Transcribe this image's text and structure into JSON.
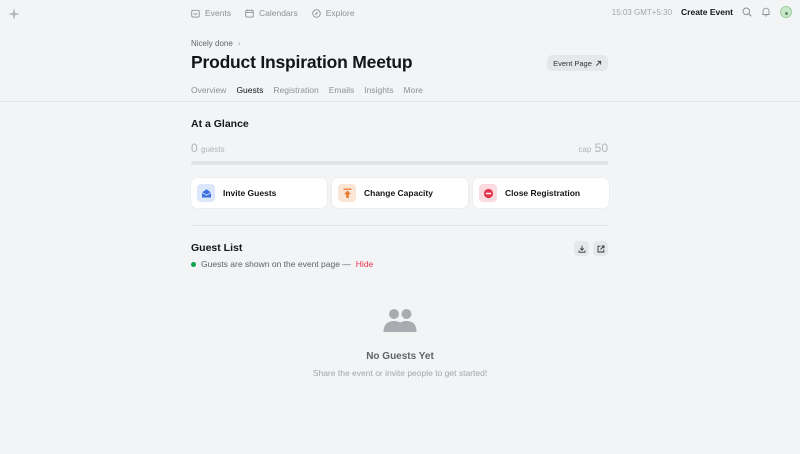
{
  "nav": {
    "links": [
      {
        "label": "Events",
        "icon": "calendar-ticket-icon"
      },
      {
        "label": "Calendars",
        "icon": "calendar-icon"
      },
      {
        "label": "Explore",
        "icon": "compass-icon"
      }
    ],
    "time": "15:03 GMT+5:30",
    "create_label": "Create Event"
  },
  "header": {
    "breadcrumb": "Nicely done",
    "title": "Product Inspiration Meetup",
    "event_page_label": "Event Page",
    "tabs": [
      "Overview",
      "Guests",
      "Registration",
      "Emails",
      "Insights",
      "More"
    ],
    "active_tab": "Guests"
  },
  "glance": {
    "title": "At a Glance",
    "guest_count": "0",
    "guest_unit": "guests",
    "cap_unit": "cap",
    "cap_value": "50",
    "progress_fraction": 0,
    "actions": [
      {
        "label": "Invite Guests",
        "icon": "envelope-icon",
        "color": "#3b6fe0",
        "bg": "#dde7fb"
      },
      {
        "label": "Change Capacity",
        "icon": "capacity-arrow-up-icon",
        "color": "#e87a2f",
        "bg": "#fbe6d6"
      },
      {
        "label": "Close Registration",
        "icon": "stop-circle-icon",
        "color": "#e5344d",
        "bg": "#fadbe0"
      }
    ]
  },
  "guest_list": {
    "title": "Guest List",
    "shown_text": "Guests are shown on the event page —",
    "hide_label": "Hide",
    "empty_title": "No Guests Yet",
    "empty_subtitle": "Share the event or invite people to get started!"
  },
  "colors": {
    "accent_red": "#e5344d",
    "status_green": "#12a150"
  }
}
